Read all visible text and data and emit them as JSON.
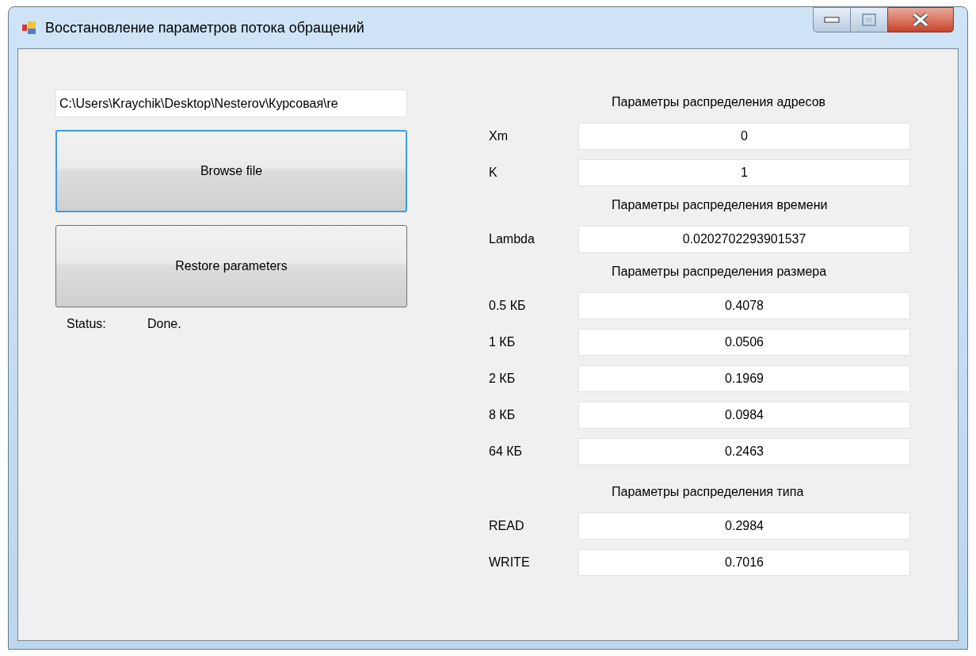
{
  "window": {
    "title": "Восстановление параметров потока обращений"
  },
  "path_field": {
    "value": "C:\\Users\\Kraychik\\Desktop\\Nesterov\\Курсовая\\re"
  },
  "buttons": [
    {
      "label": "Browse file",
      "focused": true
    },
    {
      "label": "Restore parameters",
      "focused": false
    }
  ],
  "status": {
    "label": "Status:",
    "value": "Done."
  },
  "sections": [
    {
      "heading": "Параметры распределения адресов",
      "rows": [
        {
          "label": "Xm",
          "value": "0"
        },
        {
          "label": "K",
          "value": "1"
        }
      ]
    },
    {
      "heading": "Параметры распределения времени",
      "rows": [
        {
          "label": "Lambda",
          "value": "0.0202702293901537"
        }
      ]
    },
    {
      "heading": "Параметры распределения размера",
      "rows": [
        {
          "label": "0.5 КБ",
          "value": "0.4078"
        },
        {
          "label": "1 КБ",
          "value": "0.0506"
        },
        {
          "label": "2 КБ",
          "value": "0.1969"
        },
        {
          "label": "8 КБ",
          "value": "0.0984"
        },
        {
          "label": "64 КБ",
          "value": "0.2463"
        }
      ]
    },
    {
      "heading": "Параметры распределения типа",
      "rows": [
        {
          "label": "READ",
          "value": "0.2984"
        },
        {
          "label": "WRITE",
          "value": "0.7016"
        }
      ]
    }
  ]
}
